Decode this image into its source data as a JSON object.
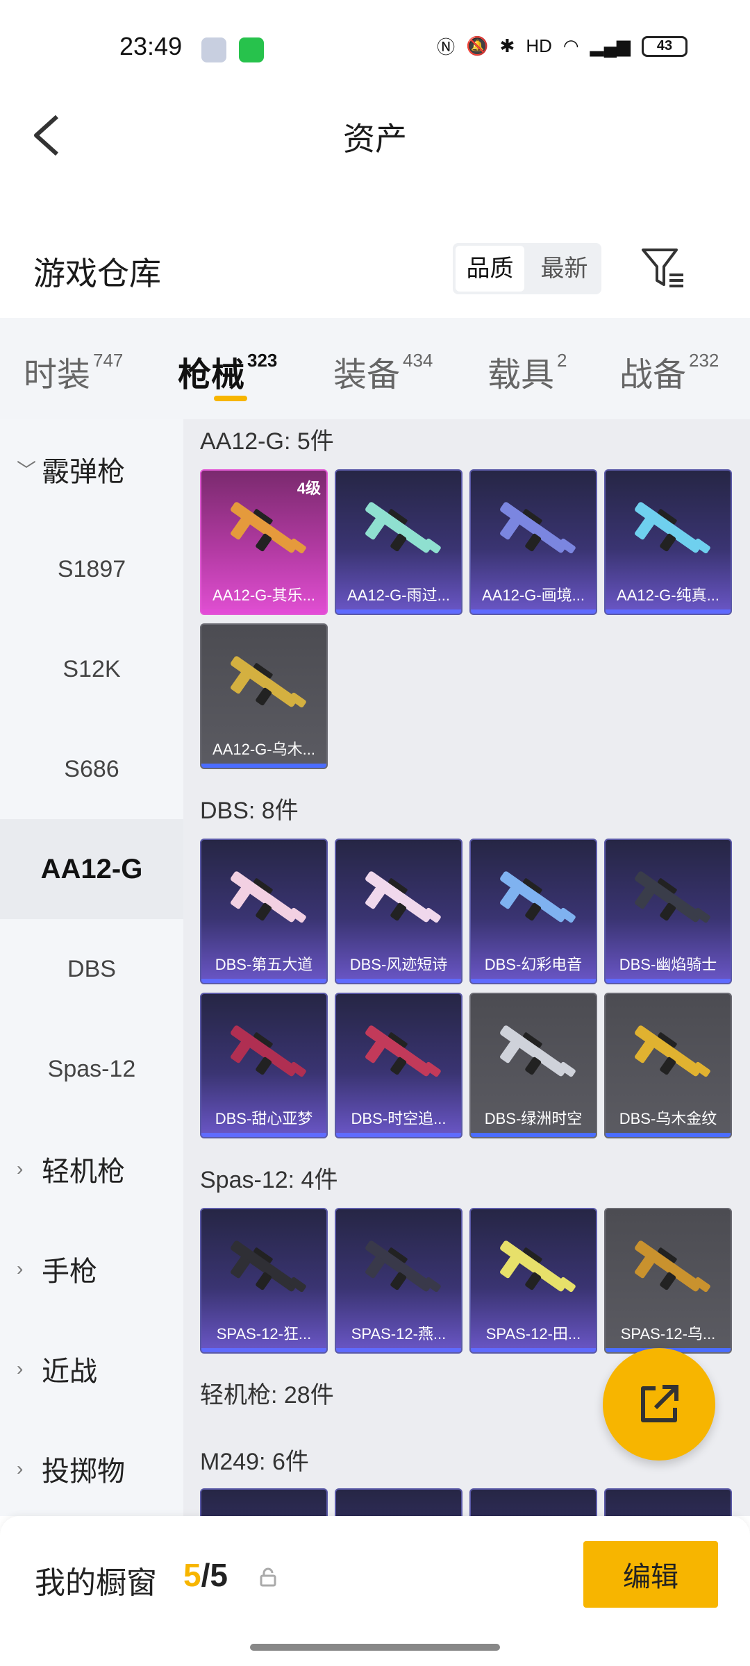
{
  "status": {
    "time": "23:49",
    "battery": "43"
  },
  "header": {
    "title": "资产"
  },
  "warehouse": {
    "title": "游戏仓库",
    "sort_options": [
      "品质",
      "最新"
    ],
    "sort_active": 0
  },
  "tabs": [
    {
      "label": "时装",
      "count": "747"
    },
    {
      "label": "枪械",
      "count": "323"
    },
    {
      "label": "装备",
      "count": "434"
    },
    {
      "label": "载具",
      "count": "2"
    },
    {
      "label": "战备",
      "count": "232"
    }
  ],
  "sidebar": {
    "items": [
      {
        "label": "霰弹枪",
        "type": "category",
        "expanded": true
      },
      {
        "label": "S1897",
        "type": "sub"
      },
      {
        "label": "S12K",
        "type": "sub"
      },
      {
        "label": "S686",
        "type": "sub"
      },
      {
        "label": "AA12-G",
        "type": "sub",
        "active": true
      },
      {
        "label": "DBS",
        "type": "sub"
      },
      {
        "label": "Spas-12",
        "type": "sub"
      },
      {
        "label": "轻机枪",
        "type": "category"
      },
      {
        "label": "手枪",
        "type": "category"
      },
      {
        "label": "近战",
        "type": "category"
      },
      {
        "label": "投掷物",
        "type": "category"
      }
    ]
  },
  "groups": [
    {
      "title": "AA12-G: 5件",
      "items": [
        {
          "name": "AA12-G-其乐...",
          "style": "pink",
          "level": "4级"
        },
        {
          "name": "AA12-G-雨过...",
          "style": "purple"
        },
        {
          "name": "AA12-G-画境...",
          "style": "purple"
        },
        {
          "name": "AA12-G-纯真...",
          "style": "purple"
        },
        {
          "name": "AA12-G-乌木...",
          "style": "gray"
        }
      ]
    },
    {
      "title": "DBS: 8件",
      "items": [
        {
          "name": "DBS-第五大道",
          "style": "purple"
        },
        {
          "name": "DBS-风迹短诗",
          "style": "purple"
        },
        {
          "name": "DBS-幻彩电音",
          "style": "purple"
        },
        {
          "name": "DBS-幽焰骑士",
          "style": "purple"
        },
        {
          "name": "DBS-甜心亚梦",
          "style": "purple"
        },
        {
          "name": "DBS-时空追...",
          "style": "purple"
        },
        {
          "name": "DBS-绿洲时空",
          "style": "gray"
        },
        {
          "name": "DBS-乌木金纹",
          "style": "gray"
        }
      ]
    },
    {
      "title": "Spas-12: 4件",
      "items": [
        {
          "name": "SPAS-12-狂...",
          "style": "purple"
        },
        {
          "name": "SPAS-12-燕...",
          "style": "purple"
        },
        {
          "name": "SPAS-12-田...",
          "style": "purple"
        },
        {
          "name": "SPAS-12-乌...",
          "style": "gray"
        }
      ]
    },
    {
      "title": "轻机枪: 28件",
      "items": []
    },
    {
      "title": "M249: 6件",
      "items": []
    }
  ],
  "bottom": {
    "window_label": "我的橱窗",
    "count_current": "5",
    "count_sep": "/",
    "count_total": "5",
    "edit_label": "编辑"
  },
  "colors": {
    "accent": "#f7b500",
    "rarity_purple": "#6b57c8",
    "rarity_gray": "#5b5b62",
    "rarity_pink": "#e04fd2"
  }
}
